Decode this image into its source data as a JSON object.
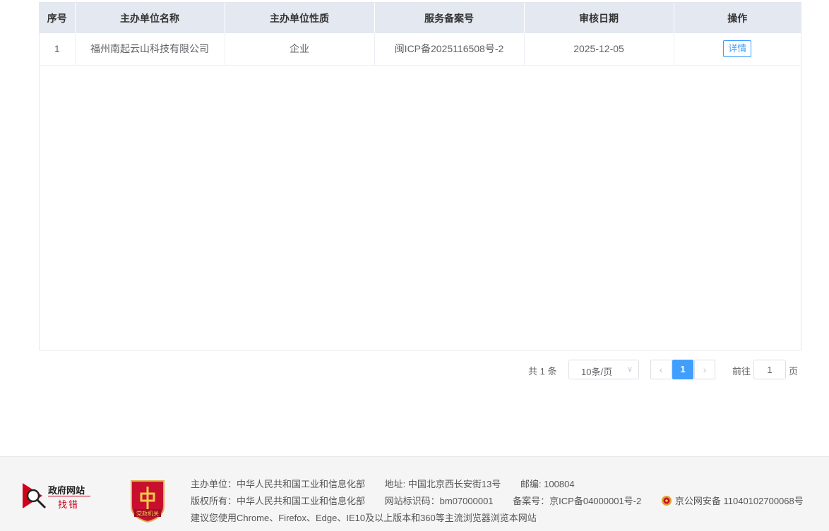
{
  "table": {
    "headers": [
      "序号",
      "主办单位名称",
      "主办单位性质",
      "服务备案号",
      "审核日期",
      "操作"
    ],
    "rows": [
      {
        "index": "1",
        "name": "福州南起云山科技有限公司",
        "nature": "企业",
        "record_no": "闽ICP备2025116508号-2",
        "date": "2025-12-05",
        "action": "详情"
      }
    ]
  },
  "pagination": {
    "total_text": "共 1 条",
    "page_size": "10条/页",
    "prev_icon": "chevron-left-icon",
    "next_icon": "chevron-right-icon",
    "current_page": "1",
    "goto_label": "前往",
    "goto_value": "1",
    "goto_suffix": "页"
  },
  "footer": {
    "gov_logo_line1": "政府网站",
    "gov_logo_line2": "找错",
    "emblem_text": "党政机关",
    "line1": {
      "organizer": "主办单位：中华人民共和国工业和信息化部",
      "address": "地址: 中国北京西长安街13号",
      "postcode": "邮编: 100804"
    },
    "line2": {
      "copyright": "版权所有：中华人民共和国工业和信息化部",
      "site_id": "网站标识码：bm07000001",
      "icp": "备案号：京ICP备04000001号-2",
      "police": "京公网安备 11040102700068号"
    },
    "line3": "建议您使用Chrome、Firefox、Edge、IE10及以上版本和360等主流浏览器浏览本网站"
  },
  "colors": {
    "header_bg": "#e4e8f1",
    "accent": "#409eff",
    "footer_bg": "#f5f5f5",
    "brand_red": "#d0021b"
  }
}
